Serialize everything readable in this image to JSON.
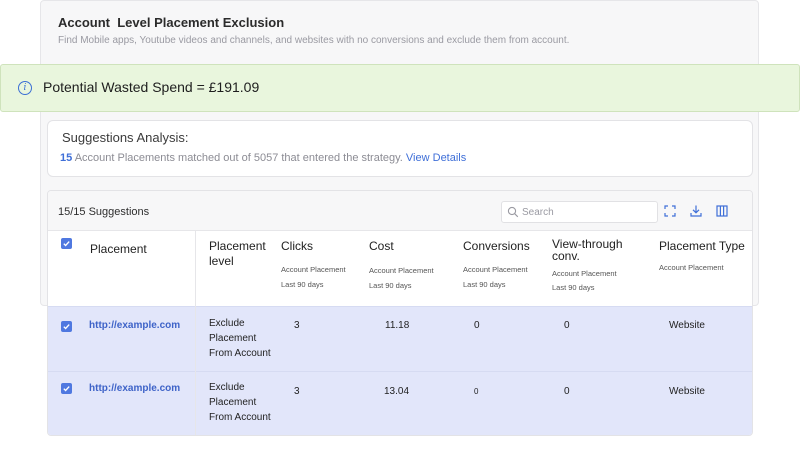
{
  "background_card": {
    "title": "Account  Level Placement Exclusion",
    "subtitle": "Find Mobile apps, Youtube videos and channels, and websites with no conversions and exclude them from account."
  },
  "banner": {
    "icon": "info-icon",
    "message": "Potential Wasted Spend = £191.09",
    "bg_color": "#e9f6dd"
  },
  "analysis": {
    "heading": "Suggestions Analysis:",
    "matched_count": "15",
    "matched_text": " Account Placements matched out of 5057 that entered the strategy. ",
    "link": "View Details"
  },
  "table": {
    "suggestions_count": "15/15 Suggestions",
    "search_placeholder": "Search",
    "toolbar_icons": [
      "expand-icon",
      "download-icon",
      "columns-icon"
    ],
    "columns": {
      "placement": "Placement",
      "placement_level": "Placement level",
      "clicks": "Clicks",
      "clicks_sub1": "Account Placement",
      "clicks_sub2": "Last 90 days",
      "cost": "Cost",
      "cost_sub1": "Account Placement",
      "cost_sub2": "Last 90 days",
      "conversions": "Conversions",
      "conversions_sub1": "Account Placement",
      "conversions_sub2": "Last 90 days",
      "view_through": "View-through conv.",
      "view_through_sub1": "Account Placement",
      "view_through_sub2": "Last 90 days",
      "placement_type": "Placement Type",
      "placement_type_sub1": "Account Placement"
    },
    "rows": [
      {
        "placement": "http://example.com",
        "level": "Exclude Placement From Account",
        "clicks": "3",
        "cost": "11.18",
        "conversions": "0",
        "view_through": "0",
        "type": "Website"
      },
      {
        "placement": "http://example.com",
        "level": "Exclude Placement From Account",
        "clicks": "3",
        "cost": "13.04",
        "conversions": "0",
        "view_through": "0",
        "type": "Website"
      }
    ],
    "accent_color": "#4f78e0",
    "selected_row_color": "#e2e6fa"
  }
}
